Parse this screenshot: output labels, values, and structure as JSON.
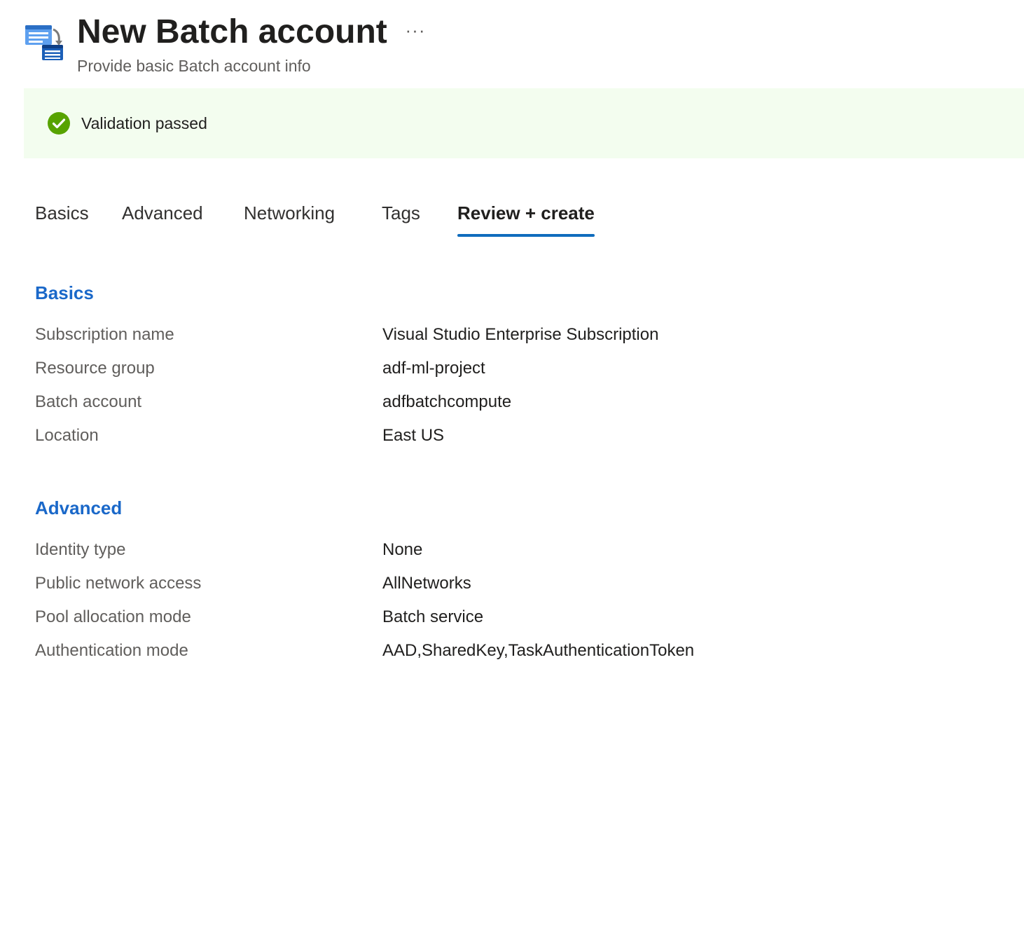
{
  "header": {
    "title": "New Batch account",
    "subtitle": "Provide basic Batch account info",
    "more_label": "···"
  },
  "banner": {
    "status": "success",
    "text": "Validation passed",
    "color": "#57a300"
  },
  "tabs": [
    {
      "label": "Basics",
      "active": false
    },
    {
      "label": "Advanced",
      "active": false
    },
    {
      "label": "Networking",
      "active": false
    },
    {
      "label": "Tags",
      "active": false
    },
    {
      "label": "Review + create",
      "active": true
    }
  ],
  "sections": [
    {
      "title": "Basics",
      "rows": [
        {
          "label": "Subscription name",
          "value": "Visual Studio Enterprise Subscription"
        },
        {
          "label": "Resource group",
          "value": "adf-ml-project"
        },
        {
          "label": "Batch account",
          "value": "adfbatchcompute"
        },
        {
          "label": "Location",
          "value": "East US"
        }
      ]
    },
    {
      "title": "Advanced",
      "rows": [
        {
          "label": "Identity type",
          "value": "None"
        },
        {
          "label": "Public network access",
          "value": "AllNetworks"
        },
        {
          "label": "Pool allocation mode",
          "value": "Batch service"
        },
        {
          "label": "Authentication mode",
          "value": "AAD,SharedKey,TaskAuthenticationToken"
        }
      ]
    }
  ],
  "colors": {
    "accent": "#0f6cbd",
    "section_heading": "#1a68c9",
    "banner_background": "#f3fdef"
  }
}
